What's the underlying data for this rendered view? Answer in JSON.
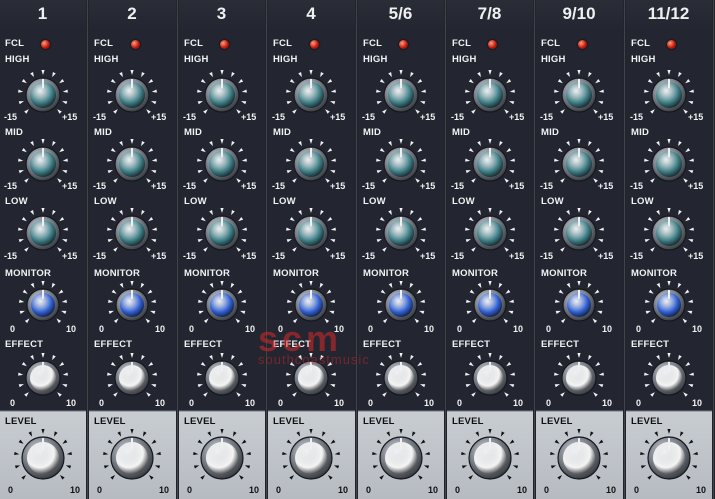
{
  "labels": {
    "fcl": "FCL",
    "high": "HIGH",
    "mid": "MID",
    "low": "LOW",
    "monitor": "MONITOR",
    "effect": "EFFECT",
    "level": "LEVEL",
    "eq_min": "-15",
    "eq_max": "+15",
    "send_min": "0",
    "send_max": "10"
  },
  "channels": [
    {
      "label": "1"
    },
    {
      "label": "2"
    },
    {
      "label": "3"
    },
    {
      "label": "4"
    },
    {
      "label": "5/6"
    },
    {
      "label": "7/8"
    },
    {
      "label": "9/10"
    },
    {
      "label": "11/12"
    }
  ],
  "watermark": {
    "logo": "scm",
    "text": "southcoastmusic"
  },
  "colors": {
    "panel": "#232631",
    "eq_cap": "#3d7f86",
    "monitor_cap": "#2f5fd6",
    "white_cap": "#f4f4f4",
    "level_panel": "#c8cdd2",
    "led": "#d8261a"
  }
}
